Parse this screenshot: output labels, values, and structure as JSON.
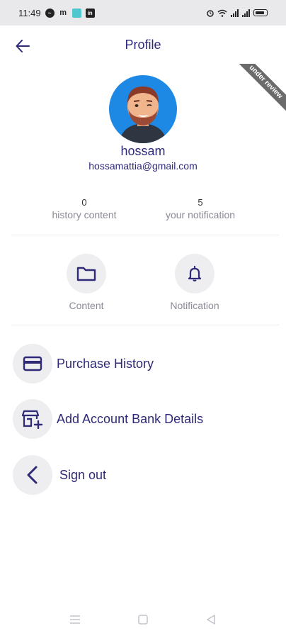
{
  "status_bar": {
    "time": "11:49",
    "left_icons": [
      "messenger-icon",
      "m-icon",
      "teal-app-icon",
      "linkedin-icon"
    ],
    "right_icons": [
      "alarm-icon",
      "wifi-icon",
      "signal-icon",
      "signal-icon",
      "battery-icon"
    ]
  },
  "app_bar": {
    "title": "Profile"
  },
  "ribbon": {
    "text": "under review"
  },
  "profile": {
    "name": "hossam",
    "email": "hossamattia@gmail.com"
  },
  "stats": [
    {
      "value": "0",
      "label": "history content"
    },
    {
      "value": "5",
      "label": "your notification"
    }
  ],
  "quick_actions": [
    {
      "label": "Content",
      "icon": "folder-icon"
    },
    {
      "label": "Notification",
      "icon": "bell-icon"
    }
  ],
  "menu": [
    {
      "label": "Purchase History",
      "icon": "credit-card-icon"
    },
    {
      "label": "Add Account Bank Details",
      "icon": "store-add-icon"
    },
    {
      "label": "Sign out",
      "icon": "chevron-left-icon"
    }
  ],
  "colors": {
    "primary": "#2e2a78",
    "muted": "#8a8a96",
    "circle_bg": "#eeeef1",
    "avatar_bg": "#1e88e5"
  }
}
